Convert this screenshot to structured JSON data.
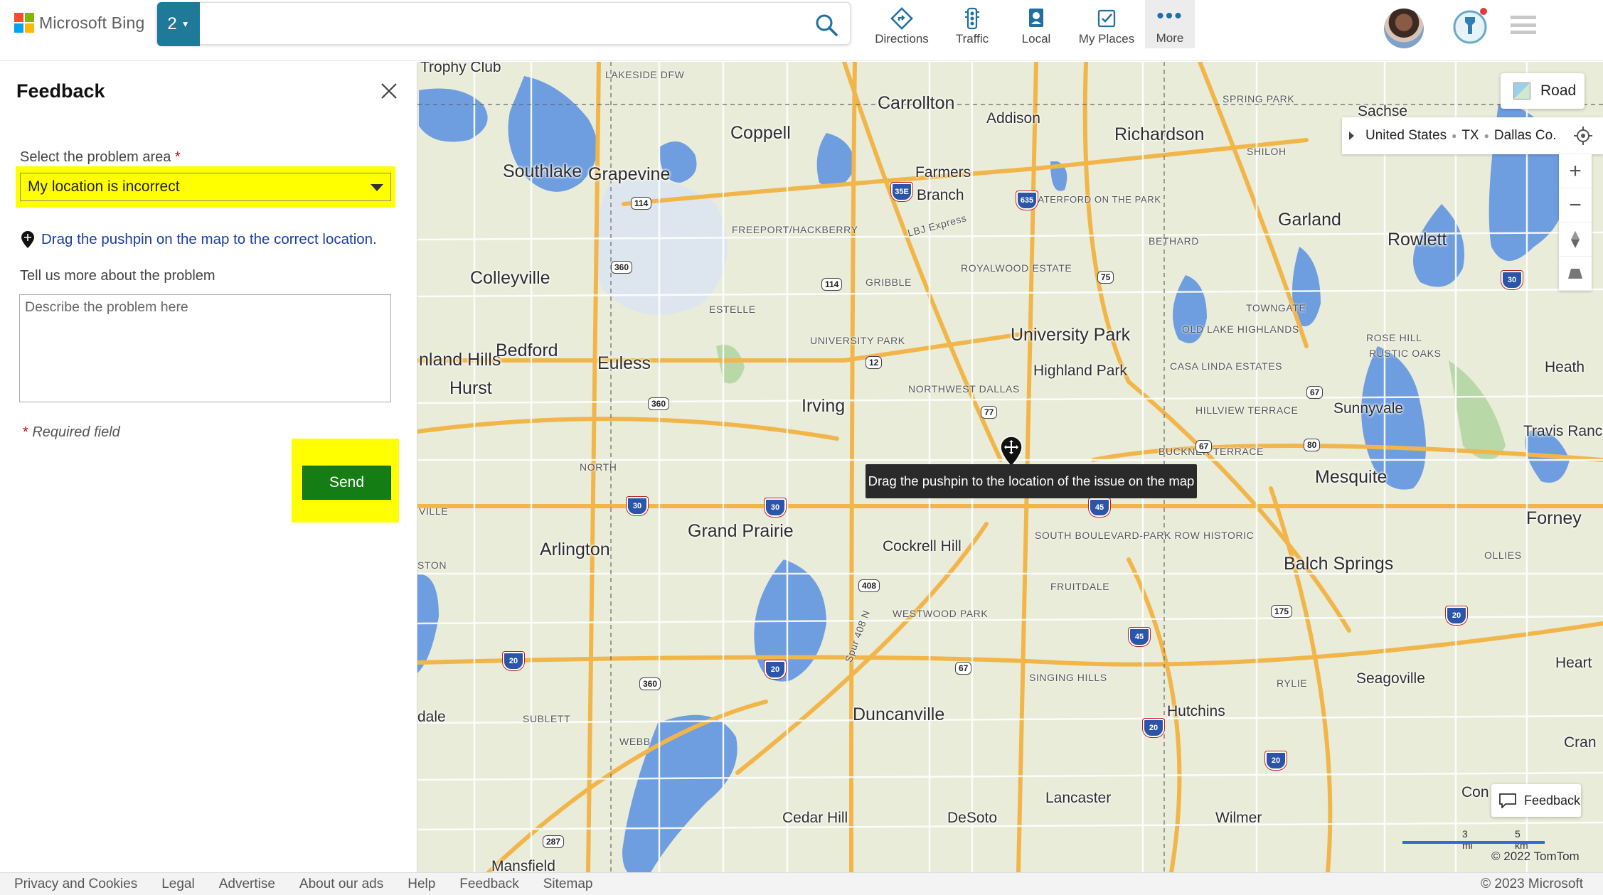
{
  "header": {
    "brand": "Microsoft Bing",
    "tab_count": "2",
    "search_value": "",
    "nav": [
      {
        "label": "Directions",
        "icon": "directions-icon"
      },
      {
        "label": "Traffic",
        "icon": "traffic-icon"
      },
      {
        "label": "Local",
        "icon": "local-icon"
      },
      {
        "label": "My Places",
        "icon": "my-places-icon"
      },
      {
        "label": "More",
        "icon": "more-icon"
      }
    ]
  },
  "feedback": {
    "title": "Feedback",
    "problem_area_label": "Select the problem area",
    "required_mark": "*",
    "problem_area_value": "My location is incorrect",
    "hint": "Drag the pushpin on the map to the correct location.",
    "details_label": "Tell us more about the problem",
    "details_placeholder": "Describe the problem here",
    "required_note": "Required field",
    "send_label": "Send",
    "highlight_color": "#ffff00",
    "send_color": "#147d14"
  },
  "map": {
    "view_button": "Road",
    "breadcrumb": [
      "United States",
      "TX",
      "Dallas Co."
    ],
    "zoom_in": "+",
    "zoom_out": "−",
    "tooltip": "Drag the pushpin to the location of the issue on the map",
    "feedback_button": "Feedback",
    "scale_mi": "3 mi",
    "scale_km": "5 km",
    "copyright": "© 2022 TomTom",
    "cities": [
      "Carrollton",
      "Addison",
      "Richardson",
      "Coppell",
      "Southlake",
      "Grapevine",
      "Farmers",
      "Branch",
      "Garland",
      "Rowlett",
      "Colleyville",
      "University Park",
      "Highland Park",
      "Bedford",
      "Euless",
      "Hurst",
      "Irving",
      "Sunnyvale",
      "Heath",
      "Travis Ranch",
      "Mesquite",
      "Forney",
      "Grand Prairie",
      "Arlington",
      "Cockrell Hill",
      "Balch Springs",
      "Seagoville",
      "Duncanville",
      "Hutchins",
      "Lancaster",
      "Cedar Hill",
      "DeSoto",
      "Wilmer",
      "Mansfield",
      "Trophy Club",
      "Sachse",
      "Heart",
      "Cran",
      "Con",
      "dale",
      "nland Hills"
    ],
    "neighborhoods": [
      "LAKESIDE DFW",
      "SPRING PARK",
      "SHILOH",
      "FREEPORT/HACKBERRY",
      "WATERFORD ON THE PARK",
      "BETHARD",
      "ROYALWOOD ESTATE",
      "GRIBBLE",
      "ESTELLE",
      "UNIVERSITY PARK",
      "TOWNGATE",
      "OLD LAKE HIGHLANDS",
      "CASA LINDA ESTATES",
      "ROSE HILL",
      "RUSTIC OAKS",
      "NORTHWEST DALLAS",
      "HILLVIEW TERRACE",
      "BUCKNER TERRACE",
      "NORTH",
      "SOUTH BOULEVARD-PARK ROW HISTORIC",
      "FRUITDALE",
      "WESTWOOD PARK",
      "OLLIES",
      "SINGING HILLS",
      "RYLIE",
      "SUBLETT",
      "WEBB",
      "STON",
      "VILLE",
      "LBJ Express",
      "Spur 408 N"
    ],
    "highways": [
      "114",
      "360",
      "114",
      "12",
      "360",
      "77",
      "67",
      "75",
      "35E",
      "635",
      "30",
      "30",
      "45",
      "67",
      "80",
      "408",
      "175",
      "20",
      "20",
      "67",
      "20",
      "45",
      "360",
      "287",
      "20",
      "30",
      "20"
    ]
  },
  "footer": {
    "links": [
      "Privacy and Cookies",
      "Legal",
      "Advertise",
      "About our ads",
      "Help",
      "Feedback",
      "Sitemap"
    ],
    "copyright": "© 2023 Microsoft"
  }
}
